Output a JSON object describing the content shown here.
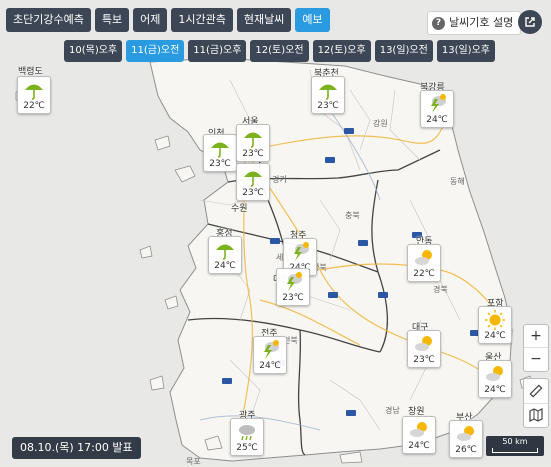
{
  "top_tabs": [
    {
      "label": "초단기강수예측",
      "active": false
    },
    {
      "label": "특보",
      "active": false
    },
    {
      "label": "어제",
      "active": false
    },
    {
      "label": "1시간관측",
      "active": false
    },
    {
      "label": "현재날씨",
      "active": false
    },
    {
      "label": "예보",
      "active": true
    }
  ],
  "legend_button": {
    "label": "날씨기호 설명",
    "icon": "question-icon"
  },
  "external_button": {
    "icon": "external-link-icon"
  },
  "time_tabs": [
    {
      "label": "10(목)오후",
      "active": false
    },
    {
      "label": "11(금)오전",
      "active": true
    },
    {
      "label": "11(금)오후",
      "active": false
    },
    {
      "label": "12(토)오전",
      "active": false
    },
    {
      "label": "12(토)오후",
      "active": false
    },
    {
      "label": "13(일)오전",
      "active": false
    },
    {
      "label": "13(일)오후",
      "active": false
    }
  ],
  "stations": [
    {
      "name": "백령도",
      "temp": "22℃",
      "icon": "umbrella-icon"
    },
    {
      "name": "북춘천",
      "temp": "23℃",
      "icon": "umbrella-icon"
    },
    {
      "name": "북강릉",
      "temp": "24℃",
      "icon": "rain-thunder-icon"
    },
    {
      "name": "인천",
      "temp": "23℃",
      "icon": "umbrella-icon"
    },
    {
      "name": "서울",
      "temp": "23℃",
      "icon": "umbrella-icon"
    },
    {
      "name": "수원",
      "temp": "23℃",
      "icon": "umbrella-icon"
    },
    {
      "name": "홍성",
      "temp": "24℃",
      "icon": "umbrella-icon"
    },
    {
      "name": "청주",
      "temp": "24℃",
      "icon": "rain-thunder-icon"
    },
    {
      "name": "대전",
      "temp": "23℃",
      "icon": "rain-thunder-icon"
    },
    {
      "name": "안동",
      "temp": "22℃",
      "icon": "partly-sunny-icon"
    },
    {
      "name": "포항",
      "temp": "24℃",
      "icon": "sunny-icon"
    },
    {
      "name": "전주",
      "temp": "24℃",
      "icon": "rain-thunder-icon"
    },
    {
      "name": "대구",
      "temp": "23℃",
      "icon": "partly-sunny-icon"
    },
    {
      "name": "울산",
      "temp": "24℃",
      "icon": "partly-sunny-icon"
    },
    {
      "name": "광주",
      "temp": "25℃",
      "icon": "cloudy-rain-icon"
    },
    {
      "name": "창원",
      "temp": "24℃",
      "icon": "partly-sunny-icon"
    },
    {
      "name": "부산",
      "temp": "26℃",
      "icon": "partly-sunny-icon"
    }
  ],
  "places": [
    "강원",
    "경기",
    "충북",
    "세",
    "정북",
    "경북",
    "경남",
    "전북",
    "전남",
    "목포",
    "동해"
  ],
  "zoom_controls": {
    "in": "+",
    "out": "−"
  },
  "tool_icons": [
    "ruler-icon",
    "map-layer-icon"
  ],
  "issued": "08.10.(목) 17:00 발표",
  "scale": "50 km",
  "colors": {
    "tab_bg": "#3d4654",
    "tab_active": "#2a9be0",
    "sea": "#e9e9e6",
    "land": "#f7f6f2",
    "rain": "#7cb21d",
    "sun": "#f5b700"
  }
}
